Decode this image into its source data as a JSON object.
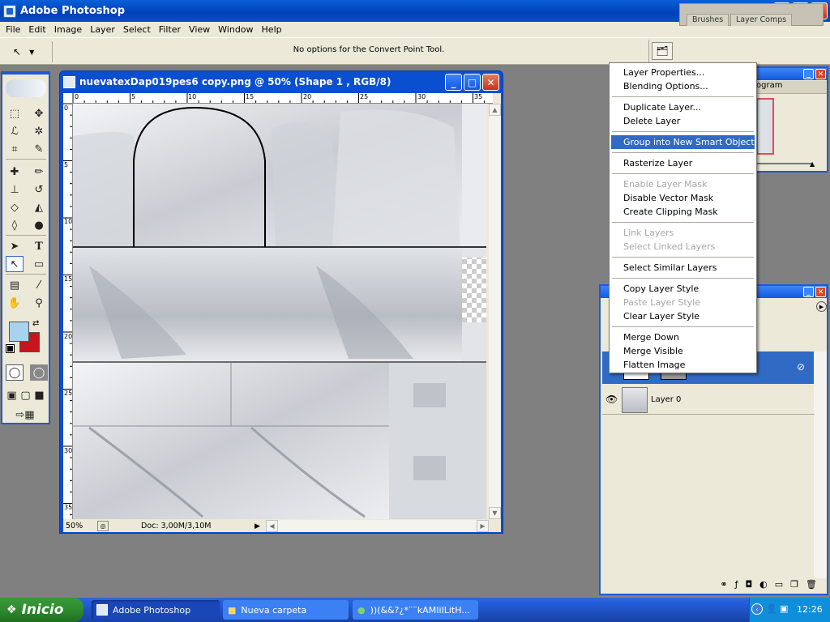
{
  "app": {
    "title": "Adobe Photoshop"
  },
  "menubar": [
    "File",
    "Edit",
    "Image",
    "Layer",
    "Select",
    "Filter",
    "View",
    "Window",
    "Help"
  ],
  "options": {
    "tool_icon": "convert-point-icon",
    "text": "No options for the Convert Point Tool."
  },
  "palette_well": {
    "tabs": [
      "Brushes",
      "Layer Comps"
    ]
  },
  "document": {
    "title": "nuevatexDap019pes6 copy.png @ 50% (Shape 1 , RGB/8)",
    "zoom": "50%",
    "doc_info": "Doc: 3,00M/3,10M",
    "ruler_top_ticks": [
      "0",
      "5",
      "10",
      "15",
      "20",
      "25",
      "30",
      "35"
    ],
    "ruler_left_ticks": [
      "0",
      "5",
      "10",
      "15",
      "20",
      "25",
      "30",
      "35"
    ]
  },
  "navigator": {
    "partial_tab": "ogram"
  },
  "layers": {
    "layer0_name": "Layer 0"
  },
  "context_menu": {
    "items": [
      {
        "label": "Layer Properties...",
        "enabled": true
      },
      {
        "label": "Blending Options...",
        "enabled": true
      },
      {
        "sep": true
      },
      {
        "label": "Duplicate Layer...",
        "enabled": true
      },
      {
        "label": "Delete Layer",
        "enabled": true
      },
      {
        "sep": true
      },
      {
        "label": "Group into New Smart Object",
        "enabled": true,
        "highlighted": true
      },
      {
        "sep": true
      },
      {
        "label": "Rasterize Layer",
        "enabled": true
      },
      {
        "sep": true
      },
      {
        "label": "Enable Layer Mask",
        "enabled": false
      },
      {
        "label": "Disable Vector Mask",
        "enabled": true
      },
      {
        "label": "Create Clipping Mask",
        "enabled": true
      },
      {
        "sep": true
      },
      {
        "label": "Link Layers",
        "enabled": false
      },
      {
        "label": "Select Linked Layers",
        "enabled": false
      },
      {
        "sep": true
      },
      {
        "label": "Select Similar Layers",
        "enabled": true
      },
      {
        "sep": true
      },
      {
        "label": "Copy Layer Style",
        "enabled": true
      },
      {
        "label": "Paste Layer Style",
        "enabled": false
      },
      {
        "label": "Clear Layer Style",
        "enabled": true
      },
      {
        "sep": true
      },
      {
        "label": "Merge Down",
        "enabled": true
      },
      {
        "label": "Merge Visible",
        "enabled": true
      },
      {
        "label": "Flatten Image",
        "enabled": true
      }
    ]
  },
  "taskbar": {
    "start": "Inicio",
    "buttons": [
      "Adobe Photoshop",
      "Nueva carpeta",
      "))(&&?¿*¨¨kAMIiILitH..."
    ],
    "clock": "12:26"
  },
  "colors": {
    "foreground": "#a9d2ee",
    "background": "#c8141c",
    "accent": "#316ac5",
    "titlebar": "#0a4fd0"
  }
}
